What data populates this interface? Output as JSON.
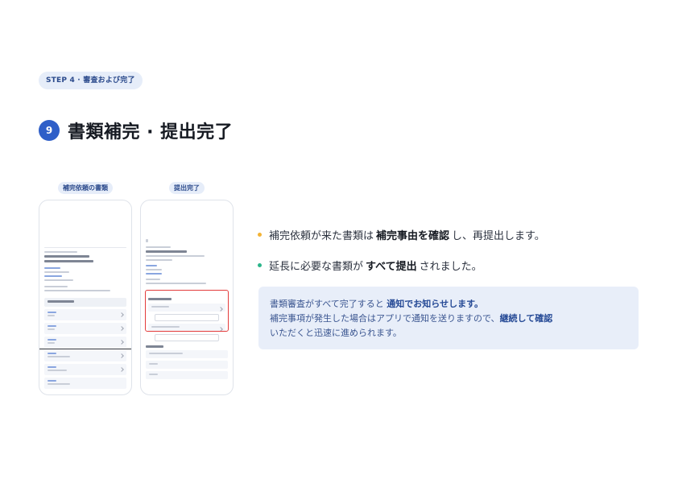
{
  "step_pill": "STEP 4 · 審査および完了",
  "section_number": "9",
  "title": "書類補完 · 提出完了",
  "screens": {
    "left_caption": "補完依頼の書類",
    "right_caption": "提出完了"
  },
  "bullets": [
    {
      "color": "#f3b335",
      "pre": "補完依頼が来た書類は",
      "bold": "補完事由を確認",
      "post": "し、再提出します。"
    },
    {
      "color": "#2bb58a",
      "pre": "延長に必要な書類が",
      "bold": "すべて提出",
      "post": "されました。"
    }
  ],
  "notice": {
    "line1_pre": "書類審査がすべて完了すると",
    "line1_bold": "通知でお知らせします。",
    "line2_pre": "補完事項が発生した場合はアプリで通知を送りますので、",
    "line2_bold": "継続して確認",
    "line3": "いただくと迅速に進められます。"
  },
  "colors": {
    "accent": "#2f5fc8",
    "pill_bg": "#e6edf9",
    "notice_bg": "#e8eef9",
    "highlight": "#e33b3b"
  }
}
